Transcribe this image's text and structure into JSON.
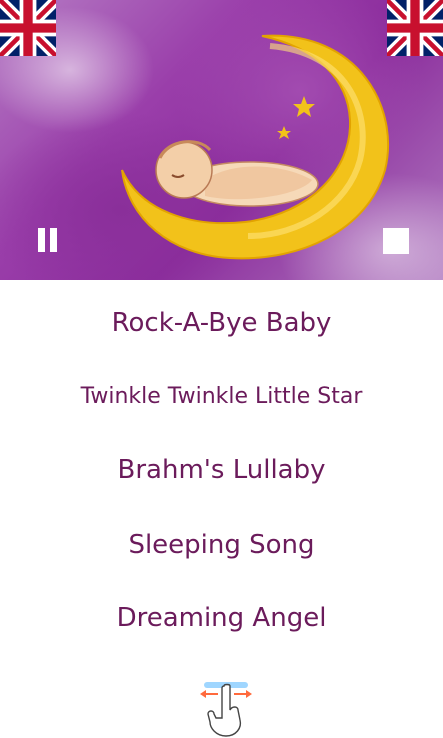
{
  "header": {
    "left_flag_icon": "uk-flag-icon",
    "right_flag_icon": "uk-flag-icon",
    "artwork": "moon-sleeping-baby-illustration",
    "pause_icon": "pause-icon",
    "stop_icon": "stop-icon"
  },
  "songs": [
    {
      "label": "Rock-A-Bye Baby"
    },
    {
      "label": "Twinkle Twinkle Little Star"
    },
    {
      "label": "Brahm's Lullaby"
    },
    {
      "label": "Sleeping Song"
    },
    {
      "label": "Dreaming Angel"
    }
  ],
  "footer": {
    "swipe_icon": "swipe-hint-icon"
  },
  "colors": {
    "song_text": "#6b1b5b",
    "hero_purple": "#9a3eaa",
    "moon_yellow": "#f2c21a"
  }
}
